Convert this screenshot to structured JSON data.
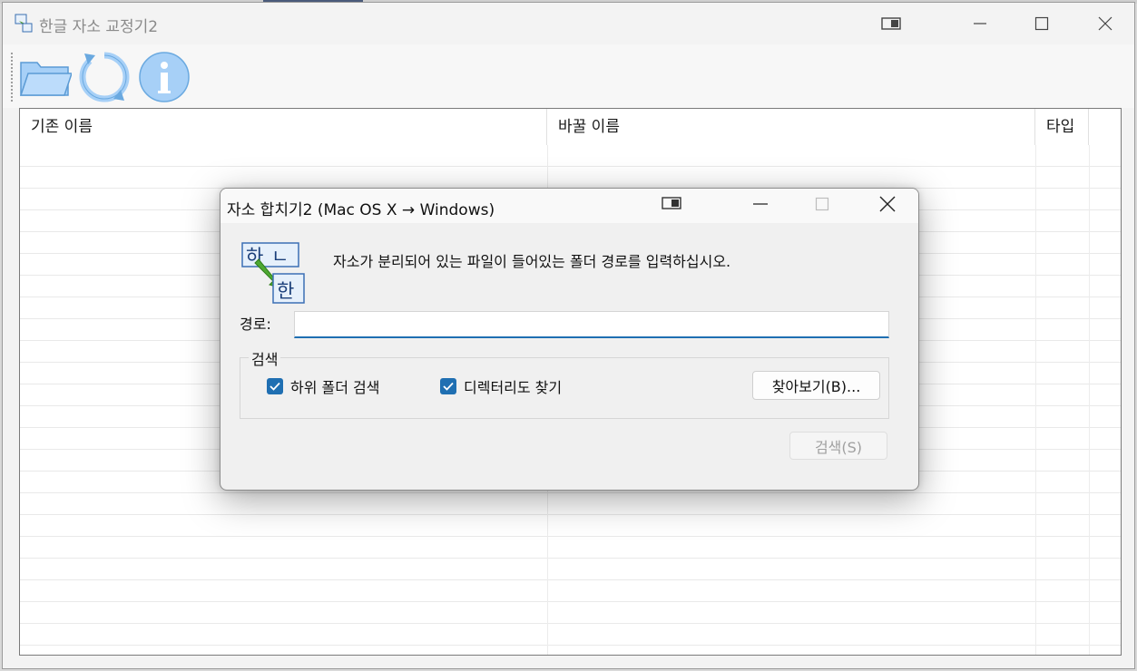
{
  "main_window": {
    "title": "한글 자소 교정기2",
    "columns": [
      {
        "label": "기존 이름"
      },
      {
        "label": "바꿀 이름"
      },
      {
        "label": "타입"
      }
    ]
  },
  "toolbar": {
    "buttons": [
      {
        "icon": "folder-open-icon"
      },
      {
        "icon": "refresh-icon"
      },
      {
        "icon": "info-icon"
      }
    ]
  },
  "dialog": {
    "title": "자소 합치기2 (Mac OS X → Windows)",
    "message": "자소가 분리되어 있는 파일이 들어있는 폴더 경로를 입력하십시오.",
    "path_label": "경로:",
    "path_value": "",
    "group_label": "검색",
    "subfolder_label": "하위 폴더 검색",
    "subfolder_checked": true,
    "directory_label": "디렉터리도 찾기",
    "directory_checked": true,
    "browse_label": "찾아보기(B)...",
    "search_label": "검색(S)"
  },
  "colors": {
    "accent": "#1f6fb2",
    "icon_blue": "#a7d0f7"
  }
}
